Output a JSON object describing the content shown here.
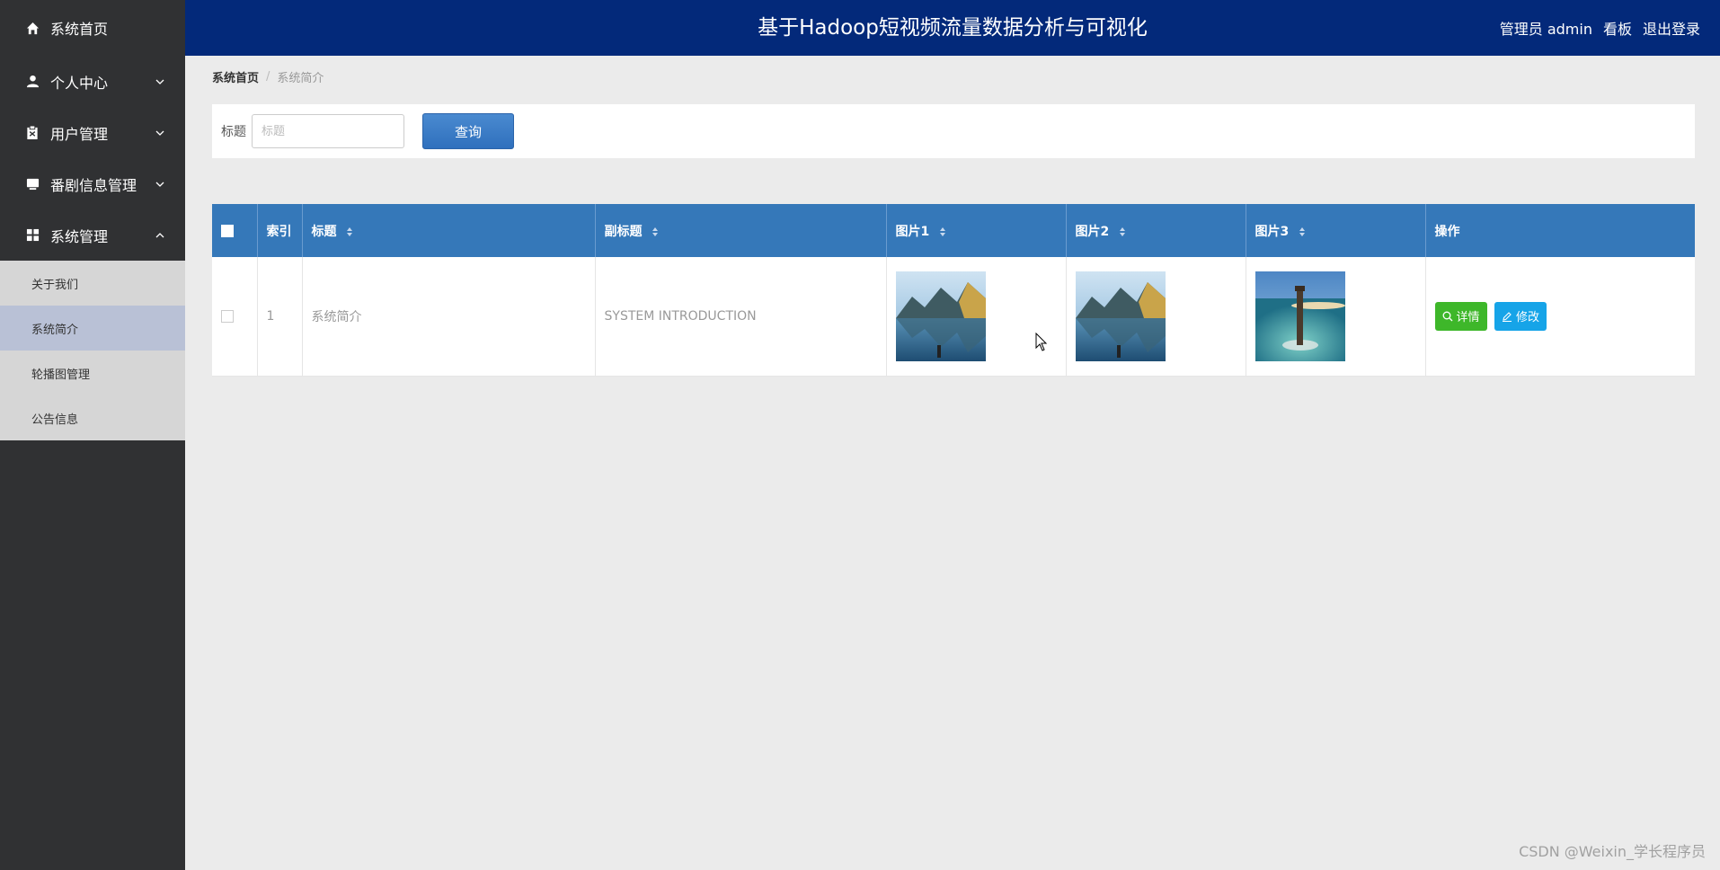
{
  "header": {
    "title": "基于Hadoop短视频流量数据分析与可视化",
    "user_label": "管理员 admin",
    "dashboard_label": "看板",
    "logout_label": "退出登录"
  },
  "sidebar": {
    "items": [
      {
        "label": "系统首页",
        "icon": "home-icon"
      },
      {
        "label": "个人中心",
        "icon": "user-icon"
      },
      {
        "label": "用户管理",
        "icon": "clipboard-icon"
      },
      {
        "label": "番剧信息管理",
        "icon": "tv-icon"
      },
      {
        "label": "系统管理",
        "icon": "grid-icon"
      }
    ],
    "subitems": [
      {
        "label": "关于我们"
      },
      {
        "label": "系统简介"
      },
      {
        "label": "轮播图管理"
      },
      {
        "label": "公告信息"
      }
    ]
  },
  "breadcrumb": {
    "home": "系统首页",
    "separator": "/",
    "current": "系统简介"
  },
  "search": {
    "label": "标题",
    "placeholder": "标题",
    "value": "",
    "button": "查询"
  },
  "table": {
    "headers": [
      "索引",
      "标题",
      "副标题",
      "图片1",
      "图片2",
      "图片3",
      "操作"
    ],
    "rows": [
      {
        "index": "1",
        "title": "系统简介",
        "subtitle": "SYSTEM INTRODUCTION",
        "detail": "详情",
        "edit": "修改"
      }
    ]
  },
  "watermark": "CSDN @Weixin_学长程序员",
  "colors": {
    "header_bg": "#03297a",
    "sidebar_bg": "#303133",
    "table_head": "#3578b9",
    "detail_btn": "#3eb72a",
    "edit_btn": "#16a4e8"
  }
}
